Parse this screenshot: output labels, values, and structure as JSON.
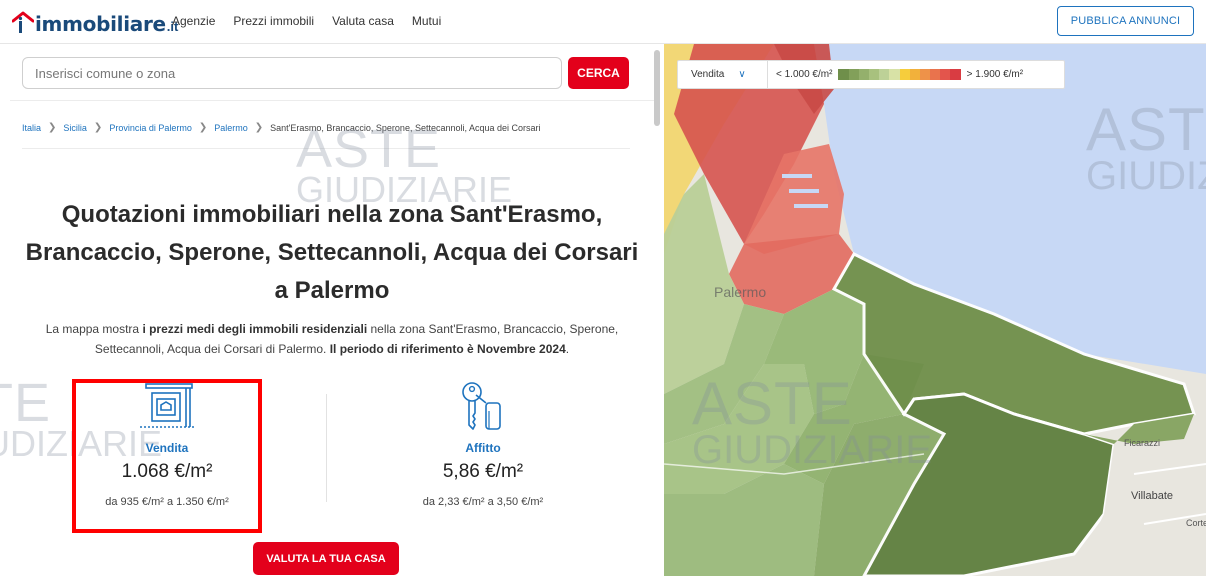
{
  "header": {
    "logo_main": "immobiliare",
    "logo_tld": ".it",
    "nav": [
      "Agenzie",
      "Prezzi immobili",
      "Valuta casa",
      "Mutui"
    ],
    "publish_label": "PUBBLICA ANNUNCI"
  },
  "search": {
    "placeholder": "Inserisci comune o zona",
    "button_label": "CERCA"
  },
  "breadcrumb": [
    "Italia",
    "Sicilia",
    "Provincia di Palermo",
    "Palermo",
    "Sant'Erasmo, Brancaccio, Sperone, Settecannoli, Acqua dei Corsari"
  ],
  "page": {
    "title": "Quotazioni immobiliari nella zona Sant'Erasmo, Brancaccio, Sperone, Settecannoli, Acqua dei Corsari a Palermo",
    "desc_1": "La mappa mostra ",
    "desc_2": "i prezzi medi degli immobili residenziali",
    "desc_3": " nella zona Sant'Erasmo, Brancaccio, Sperone, Settecannoli, Acqua dei Corsari di Palermo. ",
    "desc_4": "Il periodo di riferimento è Novembre 2024",
    "desc_5": "."
  },
  "sale": {
    "label": "Vendita",
    "price": "1.068 €/m²",
    "range": "da 935 €/m² a 1.350 €/m²"
  },
  "rent": {
    "label": "Affitto",
    "price": "5,86 €/m²",
    "range": "da 2,33 €/m² a 3,50 €/m²"
  },
  "cta_label": "VALUTA LA TUA CASA",
  "watermark": {
    "line1": "ASTE",
    "line2": "GIUDIZIARIE"
  },
  "map": {
    "select_value": "Vendita",
    "legend_min": "< 1.000 €/m²",
    "legend_max": "> 1.900 €/m²",
    "legend_colors": [
      "#6f8f4a",
      "#82a05a",
      "#94b06c",
      "#a8c17e",
      "#bdd197",
      "#d8e2a6",
      "#f6cd3c",
      "#f2b13b",
      "#ee9249",
      "#e9734d",
      "#e3554c",
      "#d93c42"
    ],
    "labels": {
      "palermo": "Palermo",
      "villabate": "Villabate",
      "ficarazzi": "Ficarazzi",
      "cortelli": "Cortell"
    }
  }
}
